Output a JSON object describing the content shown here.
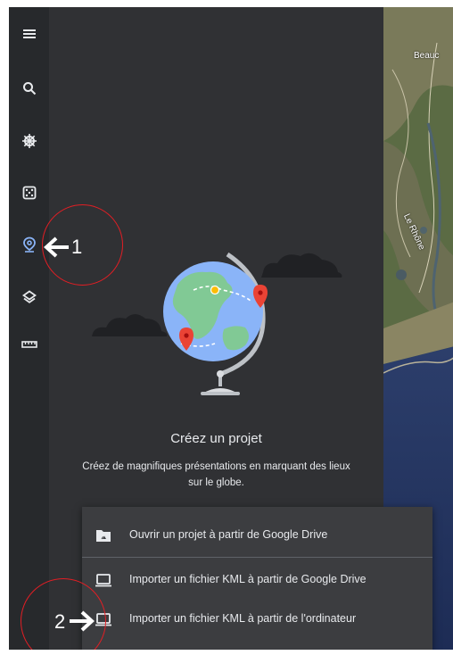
{
  "rail": {
    "items": [
      {
        "name": "menu-icon",
        "active": false
      },
      {
        "name": "search-icon",
        "active": false
      },
      {
        "name": "voyager-wheel-icon",
        "active": false
      },
      {
        "name": "feeling-lucky-dice-icon",
        "active": false
      },
      {
        "name": "projects-pin-icon",
        "active": true
      },
      {
        "name": "map-style-layers-icon",
        "active": false
      },
      {
        "name": "measure-ruler-icon",
        "active": false
      }
    ],
    "icon_color": "#e8eaed",
    "active_color": "#8ab4f8"
  },
  "panel": {
    "title": "Créez un projet",
    "description": "Créez de magnifiques présentations en marquant des lieux sur le globe."
  },
  "map": {
    "labels": [
      "Beauc",
      "Le Rhône"
    ]
  },
  "menu": {
    "items": [
      {
        "label": "Ouvrir un projet à partir de Google Drive",
        "icon": "drive-folder-icon"
      },
      {
        "label": "Importer un fichier KML à partir de Google Drive",
        "icon": "laptop-icon"
      },
      {
        "label": "Importer un fichier KML à partir de l'ordinateur",
        "icon": "laptop-icon"
      }
    ]
  },
  "annotations": {
    "marker1": "1",
    "marker2": "2",
    "color": "#e31e24"
  }
}
